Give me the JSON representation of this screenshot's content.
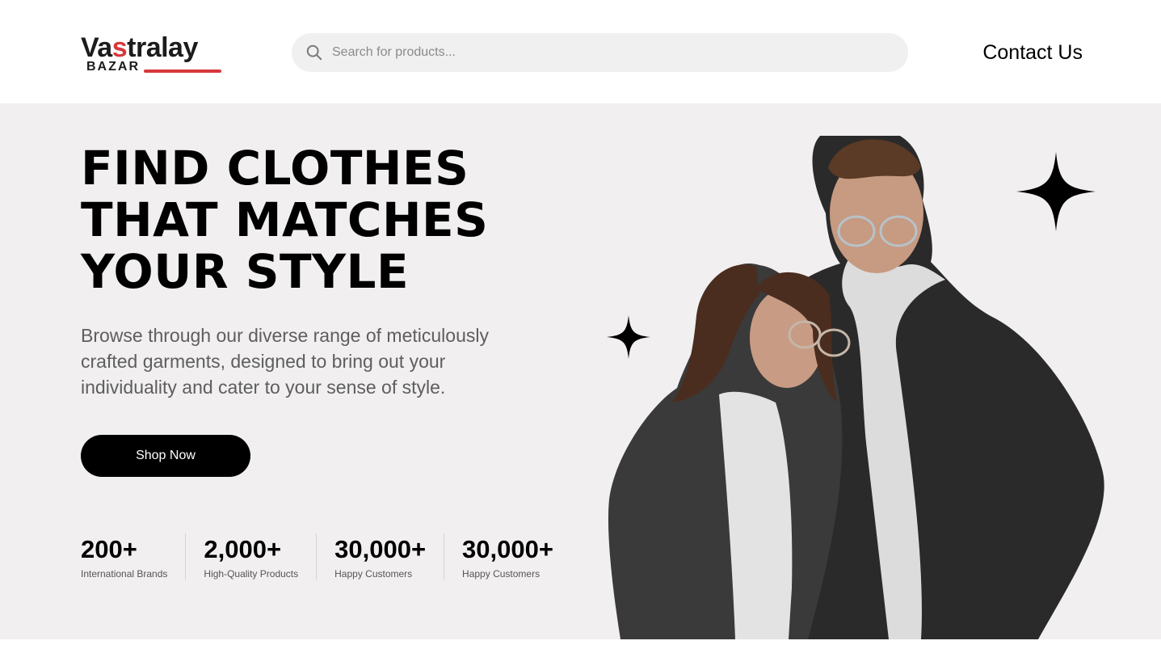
{
  "header": {
    "logo": {
      "name_part1": "Va",
      "name_accent": "s",
      "name_part2": "tralay",
      "subtitle": "BAZAR",
      "accent_color": "#d6383a"
    },
    "search": {
      "placeholder": "Search for products...",
      "value": ""
    },
    "contact_label": "Contact Us"
  },
  "hero": {
    "headline_lines": [
      "FIND CLOTHES",
      "THAT MATCHES",
      "YOUR STYLE"
    ],
    "description": "Browse through our diverse range of meticulously crafted garments, designed to bring out your individuality and cater to your sense of style.",
    "cta_label": "Shop Now",
    "stats": [
      {
        "value": "200+",
        "label": "International Brands"
      },
      {
        "value": "2,000+",
        "label": "High-Quality Products"
      },
      {
        "value": "30,000+",
        "label": "Happy Customers"
      },
      {
        "value": "30,000+",
        "label": "Happy Customers"
      }
    ],
    "background_color": "#f1eff0"
  },
  "icons": [
    "search-icon",
    "sparkle-icon",
    "sparkle-icon"
  ]
}
